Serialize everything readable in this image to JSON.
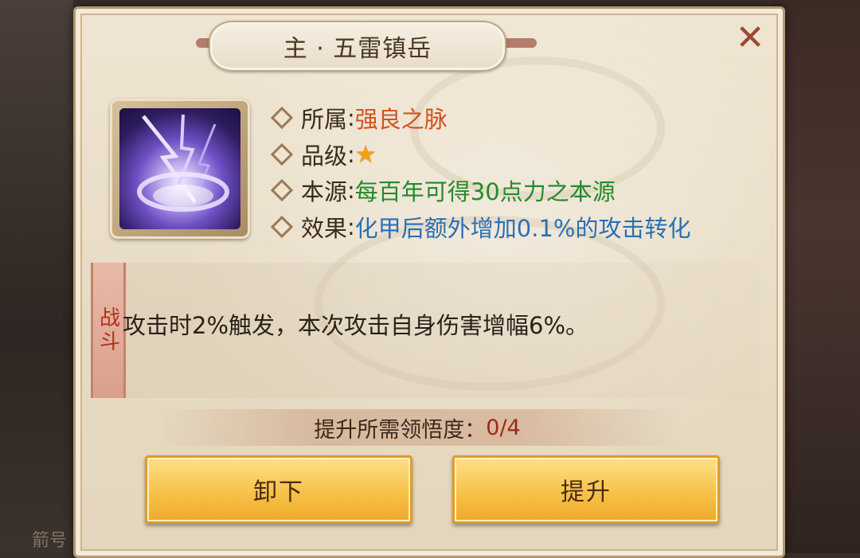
{
  "dialog": {
    "title": "主 · 五雷镇岳",
    "close_icon": "close-x-icon",
    "skill_icon": "purple-lightning-vortex-icon",
    "info": {
      "affiliation_label": "所属",
      "affiliation_value": "强良之脉",
      "grade_label": "品级",
      "grade_stars": 1,
      "source_label": "本源",
      "source_value": "每百年可得30点力之本源",
      "effect_label": "效果",
      "effect_value": "化甲后额外增加0.1%的攻击转化",
      "colon": ":"
    },
    "battle": {
      "tag": "战斗",
      "description": "攻击时2%触发，本次攻击自身伤害增幅6%。"
    },
    "requirement": {
      "label": "提升所需领悟度：",
      "value": "0/4"
    },
    "buttons": {
      "unload": "卸下",
      "upgrade": "提升"
    }
  },
  "background": {
    "bottom_text": "箭号"
  },
  "colors": {
    "affiliation": "#d2521f",
    "source": "#258a2a",
    "effect": "#2a6fb6",
    "requirement_value": "#9b2a1a",
    "button": "#f7c24a"
  }
}
